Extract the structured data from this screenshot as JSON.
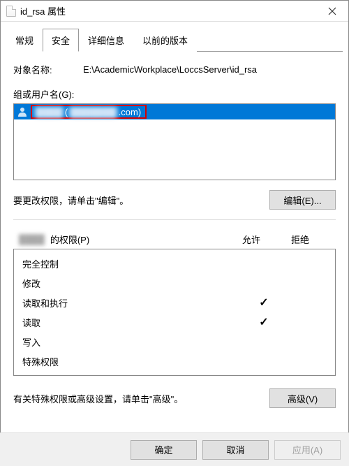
{
  "window": {
    "title": "id_rsa 属性"
  },
  "tabs": {
    "general": "常规",
    "security": "安全",
    "details": "详细信息",
    "previous": "以前的版本",
    "active": "security"
  },
  "object": {
    "label": "对象名称:",
    "value": "E:\\AcademicWorkplace\\LoccsServer\\id_rsa"
  },
  "groups": {
    "label": "组或用户名(G):",
    "items": [
      {
        "name_obscured": "████",
        "email_paren_prefix": "(",
        "email_obscured": "███████",
        "email_suffix": ".com)"
      }
    ]
  },
  "edit_hint": "要更改权限，请单击\"编辑\"。",
  "edit_button": "编辑(E)...",
  "permissions": {
    "header_user_obscured": "████",
    "header_suffix": "的权限(P)",
    "col_allow": "允许",
    "col_deny": "拒绝",
    "rows": [
      {
        "name": "完全控制",
        "allow": false,
        "deny": false
      },
      {
        "name": "修改",
        "allow": false,
        "deny": false
      },
      {
        "name": "读取和执行",
        "allow": true,
        "deny": false
      },
      {
        "name": "读取",
        "allow": true,
        "deny": false
      },
      {
        "name": "写入",
        "allow": false,
        "deny": false
      },
      {
        "name": "特殊权限",
        "allow": false,
        "deny": false
      }
    ]
  },
  "advanced_hint": "有关特殊权限或高级设置，请单击\"高级\"。",
  "advanced_button": "高级(V)",
  "footer": {
    "ok": "确定",
    "cancel": "取消",
    "apply": "应用(A)"
  }
}
